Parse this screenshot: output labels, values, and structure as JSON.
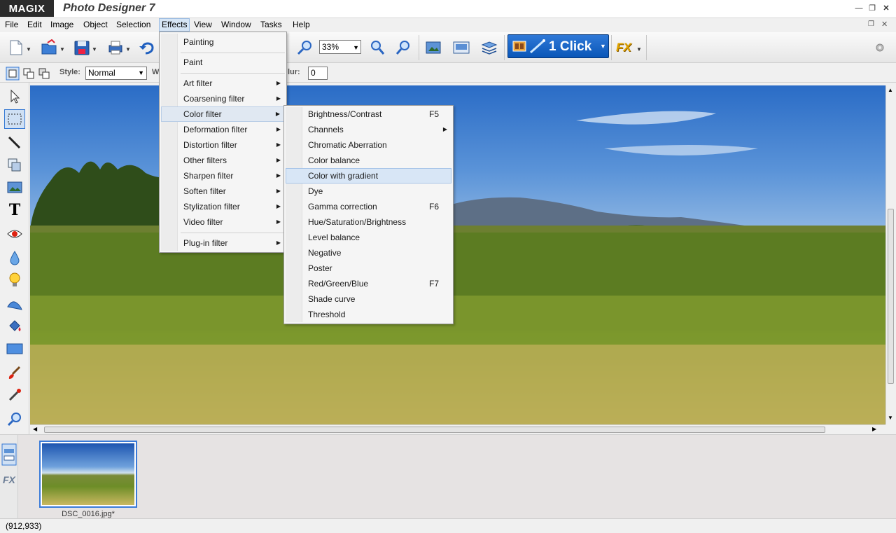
{
  "brand": "MAGIX",
  "app_title": "Photo Designer 7",
  "menubar": [
    "File",
    "Edit",
    "Image",
    "Object",
    "Selection",
    "Effects",
    "View",
    "Window",
    "Tasks",
    "Help"
  ],
  "toolbar": {
    "zoom": "33%",
    "oneclick_label": "1 Click",
    "fx_label": "FX"
  },
  "options": {
    "style_label": "Style:",
    "style_value": "Normal",
    "w_label": "W",
    "blur_label": "lur:",
    "blur_value": "0"
  },
  "effects_menu": [
    {
      "label": "Painting",
      "submenu": false
    },
    {
      "label": "Paint",
      "submenu": false
    },
    {
      "label": "Art filter",
      "submenu": true
    },
    {
      "label": "Coarsening filter",
      "submenu": true
    },
    {
      "label": "Color filter",
      "submenu": true
    },
    {
      "label": "Deformation filter",
      "submenu": true
    },
    {
      "label": "Distortion filter",
      "submenu": true
    },
    {
      "label": "Other filters",
      "submenu": true
    },
    {
      "label": "Sharpen filter",
      "submenu": true
    },
    {
      "label": "Soften filter",
      "submenu": true
    },
    {
      "label": "Stylization filter",
      "submenu": true
    },
    {
      "label": "Video filter",
      "submenu": true
    },
    {
      "label": "Plug-in filter",
      "submenu": true
    }
  ],
  "color_filter_menu": [
    {
      "label": "Brightness/Contrast",
      "shortcut": "F5"
    },
    {
      "label": "Channels",
      "shortcut": ""
    },
    {
      "label": "Chromatic Aberration",
      "shortcut": ""
    },
    {
      "label": "Color balance",
      "shortcut": ""
    },
    {
      "label": "Color with gradient",
      "shortcut": ""
    },
    {
      "label": "Dye",
      "shortcut": ""
    },
    {
      "label": "Gamma correction",
      "shortcut": "F6"
    },
    {
      "label": "Hue/Saturation/Brightness",
      "shortcut": ""
    },
    {
      "label": "Level balance",
      "shortcut": ""
    },
    {
      "label": "Negative",
      "shortcut": ""
    },
    {
      "label": "Poster",
      "shortcut": ""
    },
    {
      "label": "Red/Green/Blue",
      "shortcut": "F7"
    },
    {
      "label": "Shade curve",
      "shortcut": ""
    },
    {
      "label": "Threshold",
      "shortcut": ""
    }
  ],
  "thumbnail_caption": "DSC_0016.jpg*",
  "status": "(912,933)"
}
